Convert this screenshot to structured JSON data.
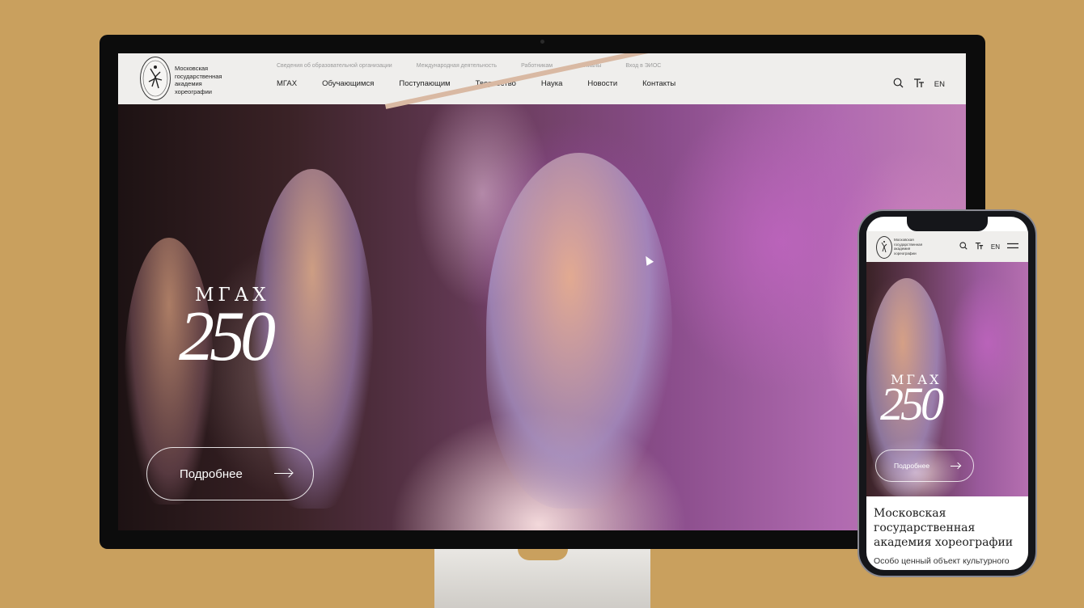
{
  "desktop": {
    "logo_text": "Московская государственная академия хореографии",
    "subnav": [
      "Сведения об образовательной организации",
      "Международная деятельность",
      "Работникам",
      "Филиалы",
      "Вход в ЭИОС"
    ],
    "mainnav": [
      "МГАХ",
      "Обучающимся",
      "Поступающим",
      "Творчество",
      "Наука",
      "Новости",
      "Контакты"
    ],
    "lang": "EN",
    "hero": {
      "title": "МГАХ",
      "number": "250",
      "button_label": "Подробнее"
    }
  },
  "mobile": {
    "logo_text": "Московская государственная академия хореографии",
    "lang": "EN",
    "hero": {
      "title": "МГАХ",
      "number": "250",
      "button_label": "Подробнее"
    },
    "heading": "Московская государственная академия хореографии",
    "subtext": "Особо ценный объект культурного"
  },
  "colors": {
    "background": "#c9a05e",
    "topbar": "#efeeec",
    "accent_purple": "#9a5a9c"
  },
  "icons": [
    "search-icon",
    "text-size-icon",
    "menu-icon",
    "arrow-right-icon",
    "logo-emblem"
  ]
}
